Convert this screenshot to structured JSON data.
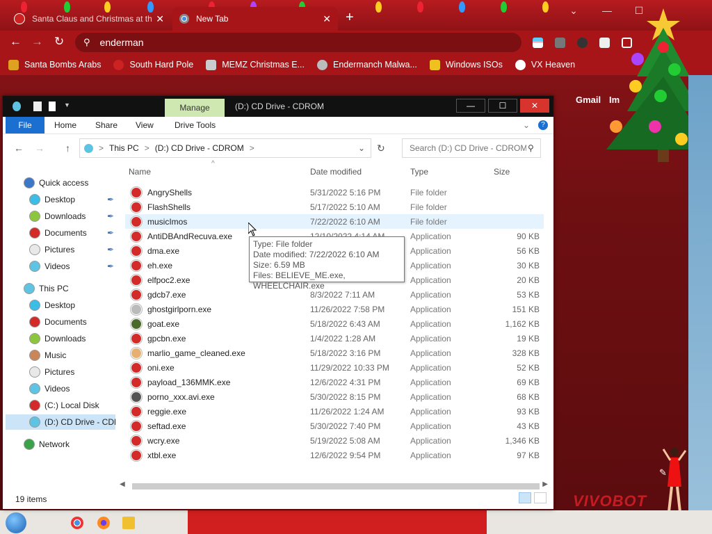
{
  "browser": {
    "tabs": [
      {
        "label": "Santa Claus and Christmas at the",
        "active": false
      },
      {
        "label": "New Tab",
        "active": true
      }
    ],
    "new_tab_label": "+",
    "window_controls": [
      "⌄",
      "—",
      "☐",
      "✕"
    ],
    "nav": {
      "back": "←",
      "forward": "→",
      "reload": "↻"
    },
    "omnibox_value": "enderman",
    "bookmarks": [
      {
        "label": "Santa Bombs Arabs",
        "color": "#e0a020"
      },
      {
        "label": "South Hard Pole",
        "color": "#ffffff"
      },
      {
        "label": "MEMZ Christmas E...",
        "color": "#cccccc"
      },
      {
        "label": "Endermanch Malwa...",
        "color": "#bbbbbb"
      },
      {
        "label": "Windows ISOs",
        "color": "#f0c020"
      },
      {
        "label": "VX Heaven",
        "color": "#ffffff"
      }
    ],
    "gmail_label": "Gmail",
    "images_label": "Im",
    "vivobot_label": "VIVOBOT",
    "theme_color": "#a81519"
  },
  "explorer": {
    "title": "(D:) CD Drive - CDROM",
    "manage_label": "Manage",
    "ribbon_tabs": [
      "File",
      "Home",
      "Share",
      "View",
      "Drive Tools"
    ],
    "address": {
      "root": "This PC",
      "current": "(D:) CD Drive - CDROM",
      "sep": ">"
    },
    "search_placeholder": "Search (D:) CD Drive - CDROM",
    "sidebar": [
      {
        "label": "Quick access",
        "level": 0,
        "color": "#3b78c7",
        "pinned": false,
        "selected": false
      },
      {
        "label": "Desktop",
        "level": 1,
        "color": "#3bbde6",
        "pinned": true,
        "selected": false
      },
      {
        "label": "Downloads",
        "level": 1,
        "color": "#8cc63e",
        "pinned": true,
        "selected": false
      },
      {
        "label": "Documents",
        "level": 1,
        "color": "#d32a2a",
        "pinned": true,
        "selected": false
      },
      {
        "label": "Pictures",
        "level": 1,
        "color": "#e8e8e8",
        "pinned": true,
        "selected": false
      },
      {
        "label": "Videos",
        "level": 1,
        "color": "#5fc3e4",
        "pinned": true,
        "selected": false
      },
      {
        "label": "This PC",
        "level": 0,
        "color": "#5fc3e4",
        "pinned": false,
        "selected": false
      },
      {
        "label": "Desktop",
        "level": 1,
        "color": "#3bbde6",
        "pinned": false,
        "selected": false
      },
      {
        "label": "Documents",
        "level": 1,
        "color": "#d32a2a",
        "pinned": false,
        "selected": false
      },
      {
        "label": "Downloads",
        "level": 1,
        "color": "#8cc63e",
        "pinned": false,
        "selected": false
      },
      {
        "label": "Music",
        "level": 1,
        "color": "#c8865a",
        "pinned": false,
        "selected": false
      },
      {
        "label": "Pictures",
        "level": 1,
        "color": "#e8e8e8",
        "pinned": false,
        "selected": false
      },
      {
        "label": "Videos",
        "level": 1,
        "color": "#5fc3e4",
        "pinned": false,
        "selected": false
      },
      {
        "label": "(C:) Local Disk",
        "level": 1,
        "color": "#d32a2a",
        "pinned": false,
        "selected": false
      },
      {
        "label": "(D:) CD Drive - CDR",
        "level": 1,
        "color": "#5fc3e4",
        "pinned": false,
        "selected": true
      },
      {
        "label": "Network",
        "level": 0,
        "color": "#3aa34a",
        "pinned": false,
        "selected": false
      }
    ],
    "columns": {
      "name": "Name",
      "date": "Date modified",
      "type": "Type",
      "size": "Size"
    },
    "files": [
      {
        "name": "AngryShells",
        "date": "5/31/2022 5:16 PM",
        "type": "File folder",
        "size": "",
        "color": "#d32a2a"
      },
      {
        "name": "FlashShells",
        "date": "5/17/2022 5:10 AM",
        "type": "File folder",
        "size": "",
        "color": "#d32a2a"
      },
      {
        "name": "musicImos",
        "date": "7/22/2022 6:10 AM",
        "type": "File folder",
        "size": "",
        "color": "#d32a2a"
      },
      {
        "name": "AntiDBAndRecuva.exe",
        "date": "12/10/2022 4:14 AM",
        "type": "Application",
        "size": "90 KB",
        "color": "#d32a2a"
      },
      {
        "name": "dma.exe",
        "date": "",
        "type": "Application",
        "size": "56 KB",
        "color": "#d32a2a"
      },
      {
        "name": "eh.exe",
        "date": "",
        "type": "Application",
        "size": "30 KB",
        "color": "#d32a2a"
      },
      {
        "name": "elfpoc2.exe",
        "date": "",
        "type": "Application",
        "size": "20 KB",
        "color": "#d32a2a"
      },
      {
        "name": "gdcb7.exe",
        "date": "8/3/2022 7:11 AM",
        "type": "Application",
        "size": "53 KB",
        "color": "#d32a2a"
      },
      {
        "name": "ghostgirlporn.exe",
        "date": "11/26/2022 7:58 PM",
        "type": "Application",
        "size": "151 KB",
        "color": "#bbbbbb"
      },
      {
        "name": "goat.exe",
        "date": "5/18/2022 6:43 AM",
        "type": "Application",
        "size": "1,162 KB",
        "color": "#4a6a2a"
      },
      {
        "name": "gpcbn.exe",
        "date": "1/4/2022 1:28 AM",
        "type": "Application",
        "size": "19 KB",
        "color": "#d32a2a"
      },
      {
        "name": "marlio_game_cleaned.exe",
        "date": "5/18/2022 3:16 PM",
        "type": "Application",
        "size": "328 KB",
        "color": "#e8b070"
      },
      {
        "name": "oni.exe",
        "date": "11/29/2022 10:33 PM",
        "type": "Application",
        "size": "52 KB",
        "color": "#d32a2a"
      },
      {
        "name": "payload_136MMK.exe",
        "date": "12/6/2022 4:31 PM",
        "type": "Application",
        "size": "69 KB",
        "color": "#d32a2a"
      },
      {
        "name": "porno_xxx.avi.exe",
        "date": "5/30/2022 8:15 PM",
        "type": "Application",
        "size": "68 KB",
        "color": "#555555"
      },
      {
        "name": "reggie.exe",
        "date": "11/26/2022 1:24 AM",
        "type": "Application",
        "size": "93 KB",
        "color": "#d32a2a"
      },
      {
        "name": "seftad.exe",
        "date": "5/30/2022 7:40 PM",
        "type": "Application",
        "size": "43 KB",
        "color": "#d32a2a"
      },
      {
        "name": "wcry.exe",
        "date": "5/19/2022 5:08 AM",
        "type": "Application",
        "size": "1,346 KB",
        "color": "#d32a2a"
      },
      {
        "name": "xtbl.exe",
        "date": "12/6/2022 9:54 PM",
        "type": "Application",
        "size": "97 KB",
        "color": "#d32a2a"
      }
    ],
    "hover_index": 2,
    "tooltip": [
      "Type: File folder",
      "Date modified: 7/22/2022 6:10 AM",
      "Size: 6.59 MB",
      "Files: BELIEVE_ME.exe, WHEELCHAIR.exe"
    ],
    "status": "19 items"
  }
}
